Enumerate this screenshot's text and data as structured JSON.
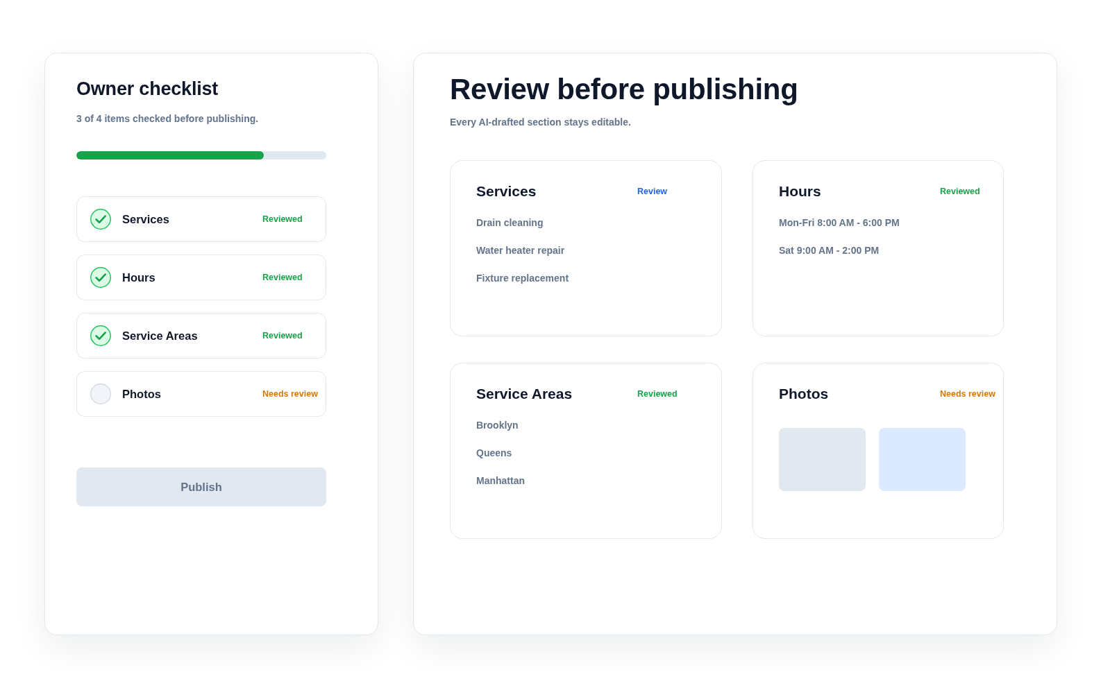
{
  "checklist": {
    "title": "Owner checklist",
    "summary": "3 of 4 items checked before publishing.",
    "progress": {
      "level": 0.75
    },
    "items": [
      {
        "label": "Services",
        "checked": true,
        "status": {
          "label": "Reviewed",
          "kind": "reviewed"
        }
      },
      {
        "label": "Hours",
        "checked": true,
        "status": {
          "label": "Reviewed",
          "kind": "reviewed"
        }
      },
      {
        "label": "Service Areas",
        "checked": true,
        "status": {
          "label": "Reviewed",
          "kind": "reviewed"
        }
      },
      {
        "label": "Photos",
        "checked": false,
        "status": {
          "label": "Needs review",
          "kind": "pending"
        }
      }
    ],
    "publish_button": {
      "label": "Publish",
      "disabled": true
    }
  },
  "review": {
    "title": "Review before publishing",
    "subtitle": "Every AI-drafted section stays editable.",
    "sections": [
      {
        "kind": "list",
        "title": "Services",
        "status": {
          "label": "Review",
          "kind": "link"
        },
        "lines": [
          "Drain cleaning",
          "Water heater repair",
          "Fixture replacement"
        ]
      },
      {
        "kind": "list",
        "title": "Hours",
        "status": {
          "label": "Reviewed",
          "kind": "reviewed"
        },
        "lines": [
          "Mon-Fri 8:00 AM - 6:00 PM",
          "Sat 9:00 AM - 2:00 PM"
        ]
      },
      {
        "kind": "list",
        "title": "Service Areas",
        "status": {
          "label": "Reviewed",
          "kind": "reviewed"
        },
        "lines": [
          "Brooklyn",
          "Queens",
          "Manhattan"
        ]
      },
      {
        "kind": "photos",
        "title": "Photos",
        "status": {
          "label": "Needs review",
          "kind": "pending"
        },
        "photos": [
          {
            "color": "#e2e8f0"
          },
          {
            "color": "#dbeafe"
          }
        ]
      }
    ]
  }
}
